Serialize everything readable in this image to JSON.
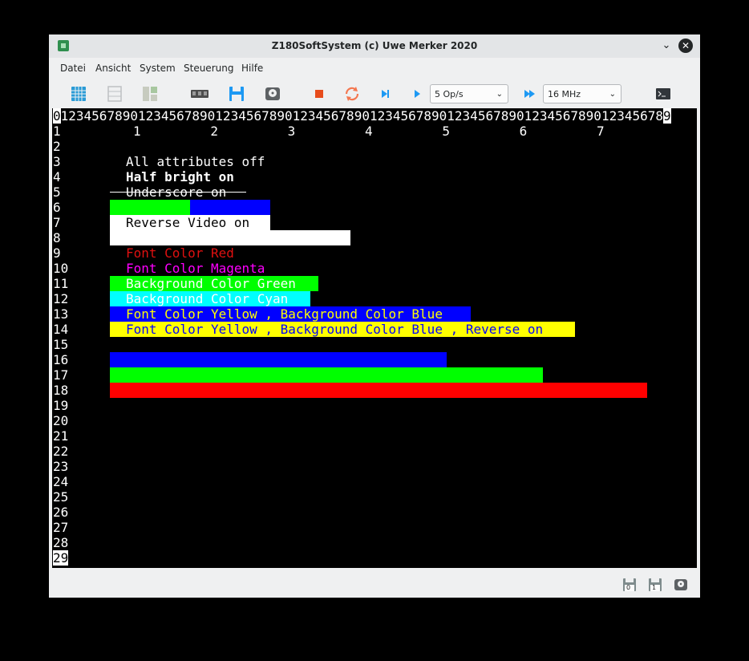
{
  "window": {
    "title": "Z180SoftSystem (c) Uwe Merker 2020"
  },
  "menu": [
    "Datei",
    "Ansicht",
    "System",
    "Steuerung",
    "Hilfe"
  ],
  "toolbar": {
    "icons": [
      "memory-grid-icon",
      "list-view-icon",
      "split-view-icon",
      "ram-module-icon",
      "save-icon",
      "disk-icon",
      "stop-icon",
      "reset-icon",
      "step-icon",
      "run-icon",
      "fast-forward-icon",
      "terminal-icon"
    ],
    "speed_value": "5 Op/s",
    "clock_value": "16 MHz"
  },
  "terminal": {
    "ruler_first": "0",
    "ruler_mid": "12345678901234567890123456789012345678901234567890123456789012345678901234567",
    "ruler_last": "8",
    "ruler_end": "9",
    "tens_ruler": "1         2         3         4         5         6         7",
    "row_numbers": [
      "1",
      "2",
      "3",
      "4",
      "5",
      "6",
      "7",
      "8",
      "9",
      "10",
      "11",
      "12",
      "13",
      "14",
      "15",
      "16",
      "17",
      "18",
      "19",
      "20",
      "21",
      "22",
      "23",
      "24",
      "25",
      "26",
      "27",
      "28",
      "29"
    ],
    "texts": {
      "attrs_off": "All attributes off",
      "half_bright": "Half bright on",
      "underscore": "Underscore on",
      "reverse": "Reverse Video on",
      "font_red": "Font Color Red",
      "font_magenta": "Font Color Magenta",
      "bg_green": "Background Color Green",
      "bg_cyan": "Background Color Cyan",
      "yellow_blue": "Font Color Yellow , Background Color Blue",
      "yellow_blue_rev": "Font Color Yellow , Background Color Blue , Reverse on"
    },
    "colors": {
      "red": "#e01010",
      "magenta": "#ff00ff",
      "green": "#00ff00",
      "cyan": "#00ffff",
      "blue": "#0000ff",
      "yellow": "#ffff00",
      "bright_red": "#ff0000"
    }
  },
  "statusbar": {
    "icons": [
      "floppy-drive-0-icon",
      "floppy-drive-1-icon",
      "hard-disk-icon"
    ],
    "drive_labels": [
      "0",
      "1"
    ]
  }
}
